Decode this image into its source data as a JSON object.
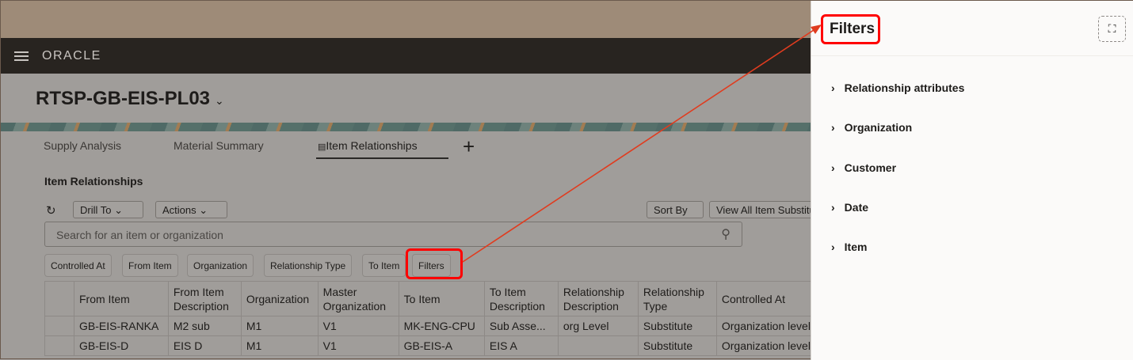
{
  "header": {
    "logo": "ORACLE",
    "title": "RTSP-GB-EIS-PL03"
  },
  "tabs": [
    {
      "label": "Supply Analysis"
    },
    {
      "label": "Material Summary"
    },
    {
      "label": "Item Relationships"
    }
  ],
  "section_title": "Item Relationships",
  "toolbar": {
    "drill_to": "Drill To",
    "actions": "Actions",
    "sort_by": "Sort By",
    "view_all": "View All Item Substitutes"
  },
  "search": {
    "placeholder": "Search for an item or organization"
  },
  "chips": [
    "Controlled At",
    "From Item",
    "Organization",
    "Relationship Type",
    "To Item",
    "Filters"
  ],
  "table": {
    "columns": [
      "From Item",
      "From Item Description",
      "Organization",
      "Master Organization",
      "To Item",
      "To Item Description",
      "Relationship Description",
      "Relationship Type",
      "Controlled At"
    ],
    "rows": [
      [
        "GB-EIS-RANKA",
        "M2 sub",
        "M1",
        "V1",
        "MK-ENG-CPU",
        "Sub Asse...",
        "org Level",
        "Substitute",
        "Organization level"
      ],
      [
        "GB-EIS-D",
        "EIS D",
        "M1",
        "V1",
        "GB-EIS-A",
        "EIS A",
        "",
        "Substitute",
        "Organization level"
      ]
    ]
  },
  "panel": {
    "title": "Filters",
    "items": [
      "Relationship attributes",
      "Organization",
      "Customer",
      "Date",
      "Item"
    ]
  },
  "colors": {
    "highlight": "#ff0000",
    "arrow": "#e03c1f"
  }
}
